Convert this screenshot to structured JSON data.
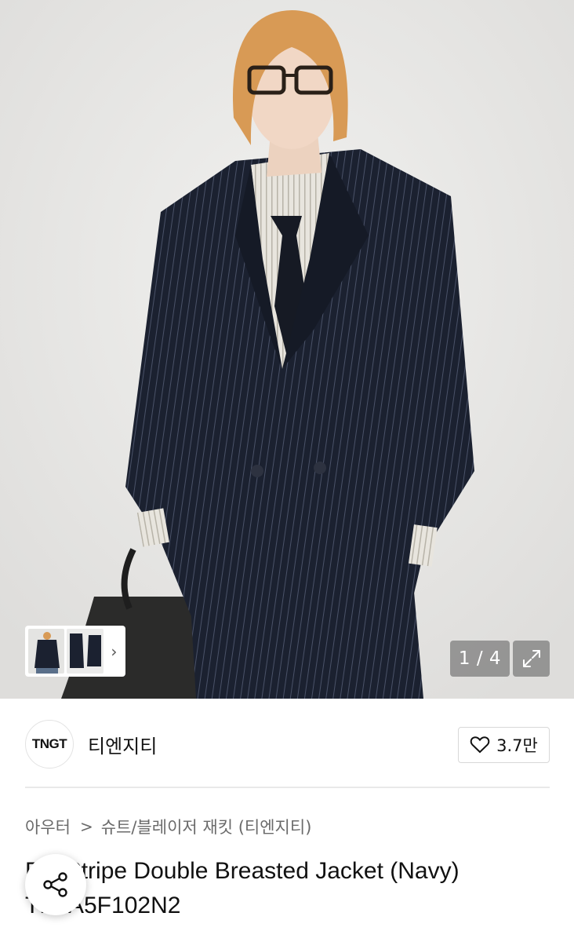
{
  "gallery": {
    "counter": "1 / 4",
    "thumbnail_more": "›"
  },
  "brand": {
    "logo_text": "TNGT",
    "name": "티엔지티",
    "like_count": "3.7만"
  },
  "breadcrumb": {
    "items": [
      "아우터",
      "슈트/블레이저 재킷 (티엔지티)"
    ],
    "separator": ">"
  },
  "product": {
    "title_line1": "Pin Stripe Double Breasted Jacket (Navy)",
    "title_line2": "TNJA5F102N2"
  },
  "icons": {
    "expand": "expand-icon",
    "heart": "heart-icon",
    "share": "share-icon",
    "chevron": "chevron-right-icon"
  }
}
